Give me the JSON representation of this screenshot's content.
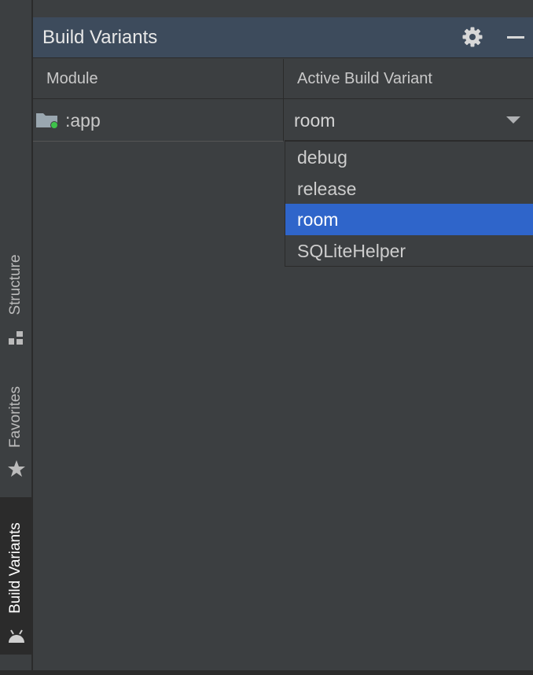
{
  "side_strip": {
    "tabs": [
      {
        "label": "Structure",
        "icon": "structure-icon",
        "active": false
      },
      {
        "label": "Favorites",
        "icon": "star-icon",
        "active": false
      },
      {
        "label": "Build Variants",
        "icon": "android-icon",
        "active": true
      }
    ]
  },
  "panel": {
    "title": "Build Variants",
    "actions": [
      {
        "icon": "gear-icon"
      },
      {
        "icon": "minimize-icon"
      }
    ]
  },
  "table": {
    "columns": [
      "Module",
      "Active Build Variant"
    ],
    "rows": [
      {
        "module": ":app",
        "variant": "room"
      }
    ]
  },
  "dropdown": {
    "options": [
      "debug",
      "release",
      "room",
      "SQLiteHelper"
    ],
    "selected": "room"
  },
  "colors": {
    "selection": "#2f65ca",
    "header": "#3d4b5c",
    "module_status": "#3ec24b"
  }
}
